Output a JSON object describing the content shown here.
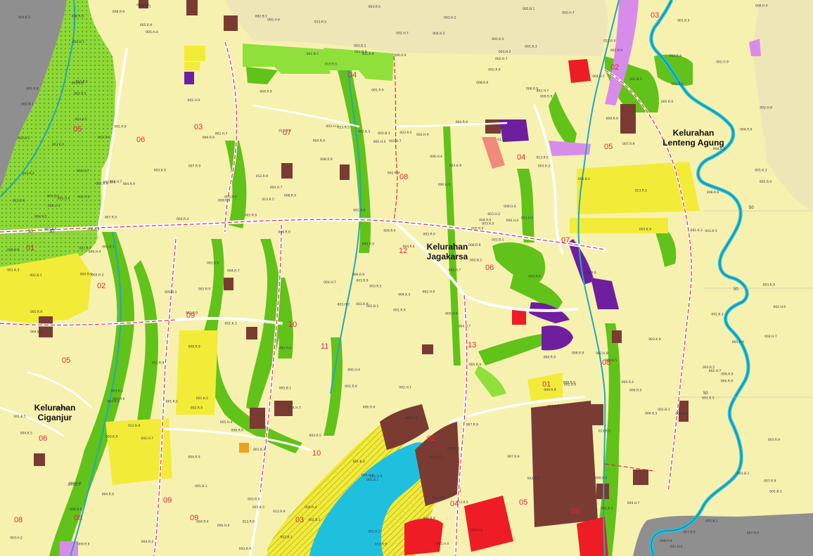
{
  "map": {
    "colors": {
      "residential": "#f7f1b0",
      "residential_dense": "#f2ec38",
      "green_park": "#61c21a",
      "green_light": "#8fe03a",
      "green_dotted": "#8ed936",
      "commercial": "#7a3b33",
      "public": "#6d1f9f",
      "office_pink": "#d88cea",
      "red": "#ee1c25",
      "salmon": "#f08a7a",
      "water": "#1fc0de",
      "river": "#23a8b8",
      "grey": "#8f8f8f",
      "road": "#ffffff",
      "boundary": "#e0283a"
    },
    "kelurahan_labels": [
      {
        "id": "jagakarsa",
        "line1": "Kelurahan",
        "line2": "Jagakarsa"
      },
      {
        "id": "lenteng",
        "line1": "Kelurahan",
        "line2": "Lenteng Agung"
      },
      {
        "id": "ciganjur",
        "line1": "Kelurahan",
        "line2": "Ciganjur"
      }
    ],
    "rw_labels": [
      "01",
      "02",
      "03",
      "04",
      "05",
      "06",
      "07",
      "08",
      "09",
      "10",
      "11",
      "12",
      "13",
      "02",
      "03",
      "04",
      "05",
      "06",
      "07",
      "08",
      "09",
      "10",
      "02",
      "03",
      "04",
      "05",
      "09",
      "01",
      "05",
      "08",
      "06",
      "08",
      "09"
    ],
    "grid_numbers": [
      "30",
      "30",
      "50",
      "50",
      "50"
    ],
    "block_codes": [
      "001.R.9",
      "002.R.9",
      "003.R.9",
      "004.R.9",
      "005.R.9",
      "006.R.9",
      "001.K.3",
      "003.R.5",
      "002.H.7",
      "004.H.7",
      "005.H.4",
      "007.R.9",
      "001.B.1",
      "002.H.9",
      "003.H.2",
      "013.R.5",
      "004.R.4",
      "001.K.5",
      "006.H.4",
      "012.R.9",
      "008.R.9",
      "009.R.9",
      "005.B.1",
      "002.B.1",
      "003.K.9",
      "004.K.5"
    ]
  }
}
